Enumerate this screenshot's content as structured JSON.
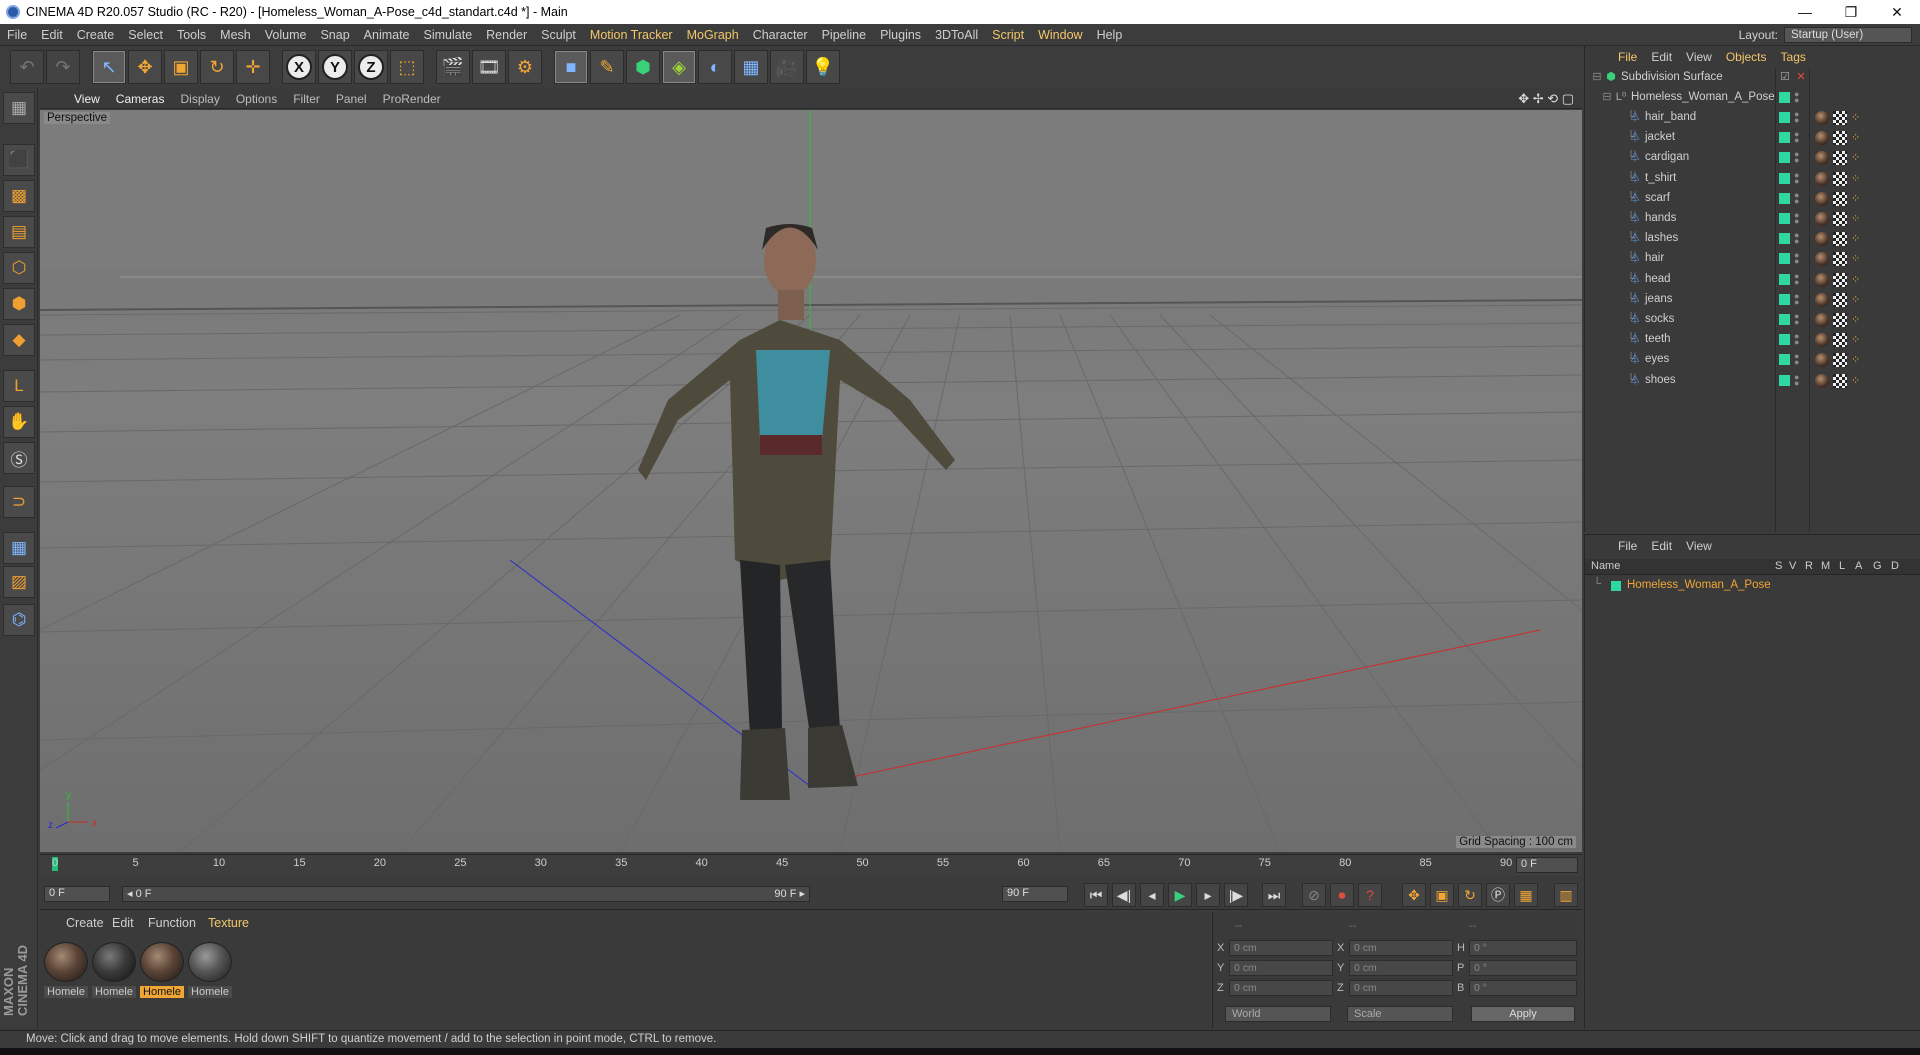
{
  "window": {
    "title": "CINEMA 4D R20.057 Studio (RC - R20) - [Homeless_Woman_A-Pose_c4d_standart.c4d *] - Main",
    "minimize": "—",
    "maximize": "❐",
    "close": "✕"
  },
  "menubar": {
    "items": [
      {
        "label": "File"
      },
      {
        "label": "Edit"
      },
      {
        "label": "Create"
      },
      {
        "label": "Select"
      },
      {
        "label": "Tools"
      },
      {
        "label": "Mesh"
      },
      {
        "label": "Volume"
      },
      {
        "label": "Snap"
      },
      {
        "label": "Animate"
      },
      {
        "label": "Simulate"
      },
      {
        "label": "Render"
      },
      {
        "label": "Sculpt"
      },
      {
        "label": "Motion Tracker"
      },
      {
        "label": "MoGraph"
      },
      {
        "label": "Character"
      },
      {
        "label": "Pipeline"
      },
      {
        "label": "Plugins"
      },
      {
        "label": "3DToAll"
      },
      {
        "label": "Script"
      },
      {
        "label": "Window"
      },
      {
        "label": "Help"
      }
    ],
    "layout_label": "Layout:",
    "layout_value": "Startup (User)"
  },
  "toolbar": {
    "undo": "↶",
    "redo": "↷",
    "select": "↖",
    "move": "✥",
    "scale": "▣",
    "rotate": "↻",
    "last": "✛",
    "axis_x": "X",
    "axis_y": "Y",
    "axis_z": "Z",
    "coord": "⬚",
    "render_view": "🎬",
    "render_pv": "🎞",
    "render_settings": "⚙",
    "cube": "■",
    "pen": "✎",
    "subdiv": "⬢",
    "deform": "◈",
    "env": "◐",
    "scene": "▦",
    "camera": "🎥",
    "light": "💡"
  },
  "viewport": {
    "menu": [
      "View",
      "Cameras",
      "Display",
      "Options",
      "Filter",
      "Panel",
      "ProRender"
    ],
    "label": "Perspective",
    "grid_spacing": "Grid Spacing : 100 cm",
    "nav_icons": "✥ ✢ ⟲ ▢",
    "axis_y": "y",
    "axis_z": "z",
    "axis_x": "x"
  },
  "timeline": {
    "ticks": [
      "0",
      "5",
      "10",
      "15",
      "20",
      "25",
      "30",
      "35",
      "40",
      "45",
      "50",
      "55",
      "60",
      "65",
      "70",
      "75",
      "80",
      "85",
      "90"
    ],
    "current_frame": "0 F"
  },
  "transport": {
    "start_frame": "0 F",
    "range_start": "◂ 0 F",
    "range_end": "90 F ▸",
    "end_frame": "90 F",
    "buttons": [
      "⏮",
      "◀|",
      "◂",
      "▶",
      "▸",
      "|▶",
      "⏭"
    ]
  },
  "materials": {
    "menu": [
      {
        "label": "Create"
      },
      {
        "label": "Edit"
      },
      {
        "label": "Function"
      },
      {
        "label": "Texture"
      }
    ],
    "items": [
      {
        "label": "Homele"
      },
      {
        "label": "Homele"
      },
      {
        "label": "Homele"
      },
      {
        "label": "Homele"
      }
    ],
    "brand_maxon": "MAXON",
    "brand_c4d": "CINEMA 4D"
  },
  "coordinates": {
    "top_left": "--",
    "top_mid": "--",
    "top_right": "--",
    "rows": [
      {
        "a": "X",
        "av": "0 cm",
        "b": "X",
        "bv": "0 cm",
        "c": "H",
        "cv": "0 °"
      },
      {
        "a": "Y",
        "av": "0 cm",
        "b": "Y",
        "bv": "0 cm",
        "c": "P",
        "cv": "0 °"
      },
      {
        "a": "Z",
        "av": "0 cm",
        "b": "Z",
        "bv": "0 cm",
        "c": "B",
        "cv": "0 °"
      }
    ],
    "space": "World",
    "mode": "Scale",
    "apply": "Apply"
  },
  "status": "Move: Click and drag to move elements. Hold down SHIFT to quantize movement / add to the selection in point mode, CTRL to remove.",
  "objects": {
    "menu": [
      {
        "label": "File"
      },
      {
        "label": "Edit"
      },
      {
        "label": "View"
      },
      {
        "label": "Objects"
      },
      {
        "label": "Tags"
      }
    ],
    "root": "Subdivision Surface",
    "group": "Homeless_Woman_A_Pose",
    "children": [
      {
        "name": "hair_band"
      },
      {
        "name": "jacket"
      },
      {
        "name": "cardigan"
      },
      {
        "name": "t_shirt"
      },
      {
        "name": "scarf"
      },
      {
        "name": "hands"
      },
      {
        "name": "lashes"
      },
      {
        "name": "hair"
      },
      {
        "name": "head"
      },
      {
        "name": "jeans"
      },
      {
        "name": "socks"
      },
      {
        "name": "teeth"
      },
      {
        "name": "eyes"
      },
      {
        "name": "shoes"
      }
    ]
  },
  "attributes": {
    "menu": [
      {
        "label": "File"
      },
      {
        "label": "Edit"
      },
      {
        "label": "View"
      }
    ],
    "col_name": "Name",
    "cols": [
      "S",
      "V",
      "R",
      "M",
      "L",
      "A",
      "G",
      "D"
    ],
    "layer": "Homeless_Woman_A_Pose"
  }
}
